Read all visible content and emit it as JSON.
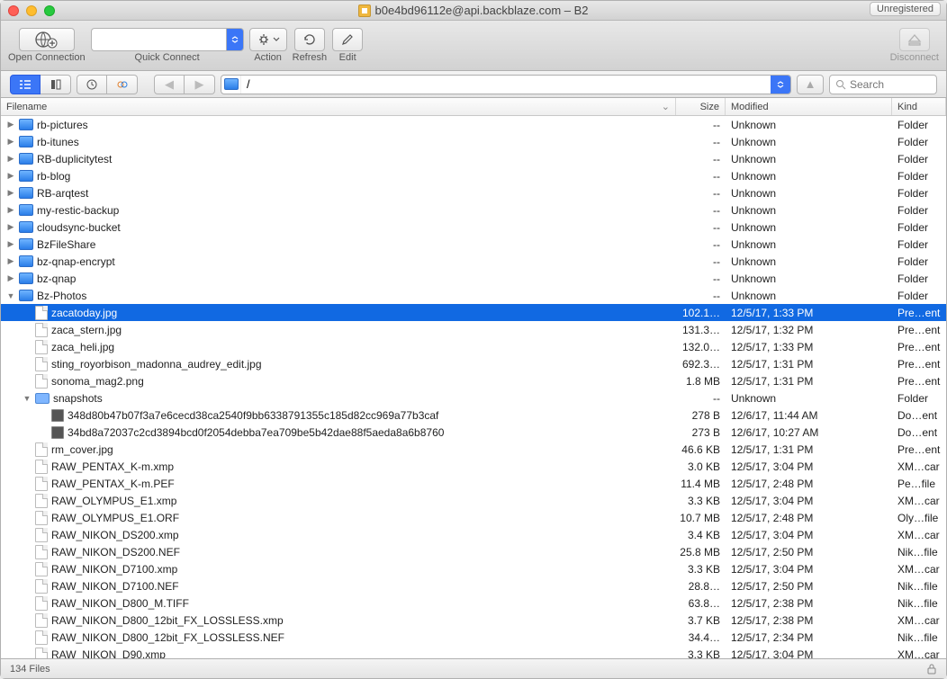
{
  "window": {
    "title": "b0e4bd96112e@api.backblaze.com – B2",
    "unregistered": "Unregistered"
  },
  "toolbar": {
    "open_connection": "Open Connection",
    "quick_connect": "Quick Connect",
    "action": "Action",
    "refresh": "Refresh",
    "edit": "Edit",
    "disconnect": "Disconnect"
  },
  "path": {
    "text": "/"
  },
  "search": {
    "placeholder": "Search"
  },
  "columns": {
    "filename": "Filename",
    "size": "Size",
    "modified": "Modified",
    "kind": "Kind"
  },
  "status": {
    "count": "134 Files"
  },
  "rows": [
    {
      "indent": 0,
      "disclosure": "right",
      "icon": "drive",
      "name": "rb-pictures",
      "size": "--",
      "mod": "Unknown",
      "kind": "Folder"
    },
    {
      "indent": 0,
      "disclosure": "right",
      "icon": "drive",
      "name": "rb-itunes",
      "size": "--",
      "mod": "Unknown",
      "kind": "Folder"
    },
    {
      "indent": 0,
      "disclosure": "right",
      "icon": "drive",
      "name": "RB-duplicitytest",
      "size": "--",
      "mod": "Unknown",
      "kind": "Folder"
    },
    {
      "indent": 0,
      "disclosure": "right",
      "icon": "drive",
      "name": "rb-blog",
      "size": "--",
      "mod": "Unknown",
      "kind": "Folder"
    },
    {
      "indent": 0,
      "disclosure": "right",
      "icon": "drive",
      "name": "RB-arqtest",
      "size": "--",
      "mod": "Unknown",
      "kind": "Folder"
    },
    {
      "indent": 0,
      "disclosure": "right",
      "icon": "drive",
      "name": "my-restic-backup",
      "size": "--",
      "mod": "Unknown",
      "kind": "Folder"
    },
    {
      "indent": 0,
      "disclosure": "right",
      "icon": "drive",
      "name": "cloudsync-bucket",
      "size": "--",
      "mod": "Unknown",
      "kind": "Folder"
    },
    {
      "indent": 0,
      "disclosure": "right",
      "icon": "drive",
      "name": "BzFileShare",
      "size": "--",
      "mod": "Unknown",
      "kind": "Folder"
    },
    {
      "indent": 0,
      "disclosure": "right",
      "icon": "drive",
      "name": "bz-qnap-encrypt",
      "size": "--",
      "mod": "Unknown",
      "kind": "Folder"
    },
    {
      "indent": 0,
      "disclosure": "right",
      "icon": "drive",
      "name": "bz-qnap",
      "size": "--",
      "mod": "Unknown",
      "kind": "Folder"
    },
    {
      "indent": 0,
      "disclosure": "down",
      "icon": "drive",
      "name": "Bz-Photos",
      "size": "--",
      "mod": "Unknown",
      "kind": "Folder"
    },
    {
      "indent": 1,
      "disclosure": "none",
      "icon": "file",
      "name": "zacatoday.jpg",
      "size": "102.1…",
      "mod": "12/5/17, 1:33 PM",
      "kind": "Pre…ent",
      "selected": true
    },
    {
      "indent": 1,
      "disclosure": "none",
      "icon": "file",
      "name": "zaca_stern.jpg",
      "size": "131.3…",
      "mod": "12/5/17, 1:32 PM",
      "kind": "Pre…ent"
    },
    {
      "indent": 1,
      "disclosure": "none",
      "icon": "file",
      "name": "zaca_heli.jpg",
      "size": "132.0…",
      "mod": "12/5/17, 1:33 PM",
      "kind": "Pre…ent"
    },
    {
      "indent": 1,
      "disclosure": "none",
      "icon": "file",
      "name": "sting_royorbison_madonna_audrey_edit.jpg",
      "size": "692.3…",
      "mod": "12/5/17, 1:31 PM",
      "kind": "Pre…ent"
    },
    {
      "indent": 1,
      "disclosure": "none",
      "icon": "file",
      "name": "sonoma_mag2.png",
      "size": "1.8 MB",
      "mod": "12/5/17, 1:31 PM",
      "kind": "Pre…ent"
    },
    {
      "indent": 1,
      "disclosure": "down",
      "icon": "folder",
      "name": "snapshots",
      "size": "--",
      "mod": "Unknown",
      "kind": "Folder"
    },
    {
      "indent": 2,
      "disclosure": "none",
      "icon": "img",
      "name": "348d80b47b07f3a7e6cecd38ca2540f9bb6338791355c185d82cc969a77b3caf",
      "size": "278 B",
      "mod": "12/6/17, 11:44 AM",
      "kind": "Do…ent"
    },
    {
      "indent": 2,
      "disclosure": "none",
      "icon": "img",
      "name": "34bd8a72037c2cd3894bcd0f2054debba7ea709be5b42dae88f5aeda8a6b8760",
      "size": "273 B",
      "mod": "12/6/17, 10:27 AM",
      "kind": "Do…ent"
    },
    {
      "indent": 1,
      "disclosure": "none",
      "icon": "file",
      "name": "rm_cover.jpg",
      "size": "46.6 KB",
      "mod": "12/5/17, 1:31 PM",
      "kind": "Pre…ent"
    },
    {
      "indent": 1,
      "disclosure": "none",
      "icon": "file",
      "name": "RAW_PENTAX_K-m.xmp",
      "size": "3.0 KB",
      "mod": "12/5/17, 3:04 PM",
      "kind": "XM…car"
    },
    {
      "indent": 1,
      "disclosure": "none",
      "icon": "file",
      "name": "RAW_PENTAX_K-m.PEF",
      "size": "11.4 MB",
      "mod": "12/5/17, 2:48 PM",
      "kind": "Pe…file"
    },
    {
      "indent": 1,
      "disclosure": "none",
      "icon": "file",
      "name": "RAW_OLYMPUS_E1.xmp",
      "size": "3.3 KB",
      "mod": "12/5/17, 3:04 PM",
      "kind": "XM…car"
    },
    {
      "indent": 1,
      "disclosure": "none",
      "icon": "file",
      "name": "RAW_OLYMPUS_E1.ORF",
      "size": "10.7 MB",
      "mod": "12/5/17, 2:48 PM",
      "kind": "Oly…file"
    },
    {
      "indent": 1,
      "disclosure": "none",
      "icon": "file",
      "name": "RAW_NIKON_DS200.xmp",
      "size": "3.4 KB",
      "mod": "12/5/17, 3:04 PM",
      "kind": "XM…car"
    },
    {
      "indent": 1,
      "disclosure": "none",
      "icon": "file",
      "name": "RAW_NIKON_DS200.NEF",
      "size": "25.8 MB",
      "mod": "12/5/17, 2:50 PM",
      "kind": "Nik…file"
    },
    {
      "indent": 1,
      "disclosure": "none",
      "icon": "file",
      "name": "RAW_NIKON_D7100.xmp",
      "size": "3.3 KB",
      "mod": "12/5/17, 3:04 PM",
      "kind": "XM…car"
    },
    {
      "indent": 1,
      "disclosure": "none",
      "icon": "file",
      "name": "RAW_NIKON_D7100.NEF",
      "size": "28.8…",
      "mod": "12/5/17, 2:50 PM",
      "kind": "Nik…file"
    },
    {
      "indent": 1,
      "disclosure": "none",
      "icon": "file",
      "name": "RAW_NIKON_D800_M.TIFF",
      "size": "63.8…",
      "mod": "12/5/17, 2:38 PM",
      "kind": "Nik…file"
    },
    {
      "indent": 1,
      "disclosure": "none",
      "icon": "file",
      "name": "RAW_NIKON_D800_12bit_FX_LOSSLESS.xmp",
      "size": "3.7 KB",
      "mod": "12/5/17, 2:38 PM",
      "kind": "XM…car"
    },
    {
      "indent": 1,
      "disclosure": "none",
      "icon": "file",
      "name": "RAW_NIKON_D800_12bit_FX_LOSSLESS.NEF",
      "size": "34.4…",
      "mod": "12/5/17, 2:34 PM",
      "kind": "Nik…file"
    },
    {
      "indent": 1,
      "disclosure": "none",
      "icon": "file",
      "name": "RAW_NIKON_D90.xmp",
      "size": "3.3 KB",
      "mod": "12/5/17, 3:04 PM",
      "kind": "XM…car"
    }
  ]
}
